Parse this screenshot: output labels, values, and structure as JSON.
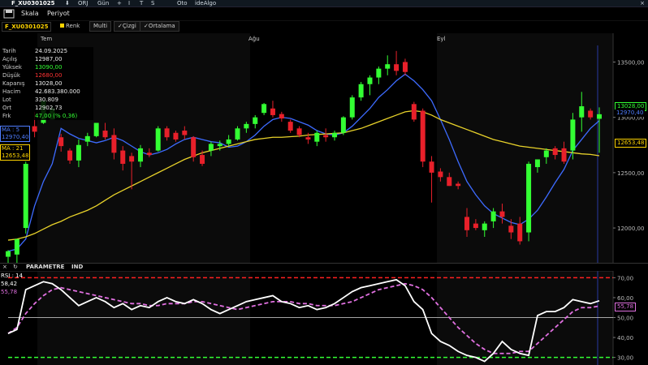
{
  "topbar": {
    "symbol": "F_XU0301025",
    "items": [
      "ORJ",
      "Gün",
      "+",
      "I",
      "T",
      "S",
      "Oto",
      "ideAlgo"
    ],
    "close": "×"
  },
  "menubar": {
    "items": [
      "Skala",
      "Periyot"
    ]
  },
  "toolbar": {
    "symbol": "F_XU0301025",
    "renk": "Renk",
    "buttons": [
      "Multi",
      "Çizgi",
      "Ortalama"
    ]
  },
  "info": {
    "rows": [
      {
        "label": "Tarih",
        "value": "24.09.2025",
        "color": "#eeeeee"
      },
      {
        "label": "Açılış",
        "value": "12987,00",
        "color": "#eeeeee"
      },
      {
        "label": "Yüksek",
        "value": "13090,00",
        "color": "#33ff33"
      },
      {
        "label": "Düşük",
        "value": "12680,00",
        "color": "#ff3333"
      },
      {
        "label": "Kapanış",
        "value": "13028,00",
        "color": "#eeeeee"
      },
      {
        "label": "Hacim",
        "value": "42.683.380.000",
        "color": "#eeeeee"
      },
      {
        "label": "Lot",
        "value": "330.809",
        "color": "#eeeeee"
      },
      {
        "label": "Ort",
        "value": "12902,73",
        "color": "#eeeeee"
      },
      {
        "label": "Frk",
        "value": "47,00 (% 0,36)",
        "color": "#33ff33"
      }
    ]
  },
  "ma5": {
    "label": "MA : 5",
    "value": "12970,40",
    "color": "#4f7dff"
  },
  "ma21": {
    "label": "MA : 21",
    "value": "12653,48",
    "color": "#ffd400"
  },
  "months": [
    "Tem",
    "Ağu",
    "Eyl"
  ],
  "indicator_header": {
    "title": "PARAMETRE",
    "ind": "IND",
    "close": "×",
    "refresh": "↻"
  },
  "rsi": {
    "label": "RSI : 14",
    "value": "58,42",
    "ma_value": "55,78"
  },
  "price_labels": {
    "last": "13028,00",
    "ma5": "12970,40",
    "ma21": "12653,48"
  },
  "rsi_labels": {
    "ma": "55,78"
  },
  "colors": {
    "up": "#33ff33",
    "down": "#e8202a",
    "ma5": "#3d6bff",
    "ma21": "#e8d22a",
    "rsi": "#ffffff",
    "rsi_ma": "#e070e0",
    "band_high": "#ff2020",
    "band_low": "#33ff33"
  },
  "chart_data": [
    {
      "type": "candlestick",
      "title": "F_XU0301025",
      "x_ticks": [
        "Tem",
        "Ağu",
        "Eyl"
      ],
      "ylim": [
        11700,
        13650
      ],
      "y_ticks": [
        12000,
        12500,
        13000,
        13500
      ],
      "y_tick_labels": [
        "12000,00",
        "12500,00",
        "13000,00",
        "13500,00"
      ],
      "grid": false,
      "candles": [
        {
          "o": 11740,
          "h": 11800,
          "l": 11680,
          "c": 11790
        },
        {
          "o": 11760,
          "h": 11900,
          "l": 11620,
          "c": 11900
        },
        {
          "o": 12000,
          "h": 12600,
          "l": 11950,
          "c": 12580
        },
        {
          "o": 12920,
          "h": 13050,
          "l": 12820,
          "c": 12870
        },
        {
          "o": 12950,
          "h": 13150,
          "l": 12940,
          "c": 13150
        },
        {
          "o": 12980,
          "h": 13100,
          "l": 12980,
          "c": 13080
        },
        {
          "o": 12820,
          "h": 12850,
          "l": 12690,
          "c": 12740
        },
        {
          "o": 12700,
          "h": 12720,
          "l": 12580,
          "c": 12610
        },
        {
          "o": 12610,
          "h": 12800,
          "l": 12550,
          "c": 12750
        },
        {
          "o": 12780,
          "h": 12860,
          "l": 12740,
          "c": 12830
        },
        {
          "o": 12830,
          "h": 12950,
          "l": 12820,
          "c": 12950
        },
        {
          "o": 12880,
          "h": 12950,
          "l": 12800,
          "c": 12820
        },
        {
          "o": 12840,
          "h": 12900,
          "l": 12620,
          "c": 12680
        },
        {
          "o": 12700,
          "h": 12740,
          "l": 12520,
          "c": 12580
        },
        {
          "o": 12650,
          "h": 12680,
          "l": 12350,
          "c": 12600
        },
        {
          "o": 12600,
          "h": 12750,
          "l": 12550,
          "c": 12720
        },
        {
          "o": 12680,
          "h": 12720,
          "l": 12640,
          "c": 12660
        },
        {
          "o": 12700,
          "h": 12920,
          "l": 12690,
          "c": 12900
        },
        {
          "o": 12900,
          "h": 12920,
          "l": 12790,
          "c": 12820
        },
        {
          "o": 12860,
          "h": 12880,
          "l": 12780,
          "c": 12800
        },
        {
          "o": 12880,
          "h": 12920,
          "l": 12800,
          "c": 12840
        },
        {
          "o": 12820,
          "h": 12830,
          "l": 12600,
          "c": 12640
        },
        {
          "o": 12660,
          "h": 12700,
          "l": 12560,
          "c": 12580
        },
        {
          "o": 12700,
          "h": 12780,
          "l": 12650,
          "c": 12760
        },
        {
          "o": 12740,
          "h": 12790,
          "l": 12700,
          "c": 12760
        },
        {
          "o": 12760,
          "h": 12840,
          "l": 12740,
          "c": 12800
        },
        {
          "o": 12800,
          "h": 12920,
          "l": 12790,
          "c": 12900
        },
        {
          "o": 12900,
          "h": 12960,
          "l": 12860,
          "c": 12940
        },
        {
          "o": 12940,
          "h": 13020,
          "l": 12900,
          "c": 13000
        },
        {
          "o": 13040,
          "h": 13130,
          "l": 13020,
          "c": 13120
        },
        {
          "o": 13080,
          "h": 13150,
          "l": 13000,
          "c": 13020
        },
        {
          "o": 13030,
          "h": 13050,
          "l": 12960,
          "c": 12990
        },
        {
          "o": 12960,
          "h": 12980,
          "l": 12860,
          "c": 12880
        },
        {
          "o": 12900,
          "h": 12920,
          "l": 12820,
          "c": 12840
        },
        {
          "o": 12820,
          "h": 12860,
          "l": 12760,
          "c": 12800
        },
        {
          "o": 12780,
          "h": 12880,
          "l": 12740,
          "c": 12860
        },
        {
          "o": 12840,
          "h": 12900,
          "l": 12780,
          "c": 12820
        },
        {
          "o": 12820,
          "h": 12880,
          "l": 12790,
          "c": 12860
        },
        {
          "o": 12860,
          "h": 13010,
          "l": 12840,
          "c": 13000
        },
        {
          "o": 13000,
          "h": 13200,
          "l": 12980,
          "c": 13180
        },
        {
          "o": 13180,
          "h": 13320,
          "l": 13150,
          "c": 13300
        },
        {
          "o": 13300,
          "h": 13380,
          "l": 13200,
          "c": 13360
        },
        {
          "o": 13360,
          "h": 13460,
          "l": 13300,
          "c": 13440
        },
        {
          "o": 13440,
          "h": 13560,
          "l": 13380,
          "c": 13480
        },
        {
          "o": 13480,
          "h": 13600,
          "l": 13380,
          "c": 13420
        },
        {
          "o": 13500,
          "h": 13530,
          "l": 13380,
          "c": 13410
        },
        {
          "o": 13120,
          "h": 13140,
          "l": 12960,
          "c": 12980
        },
        {
          "o": 13060,
          "h": 13080,
          "l": 12550,
          "c": 12600
        },
        {
          "o": 12600,
          "h": 12650,
          "l": 12230,
          "c": 12500
        },
        {
          "o": 12510,
          "h": 12540,
          "l": 12420,
          "c": 12460
        },
        {
          "o": 12460,
          "h": 12500,
          "l": 12380,
          "c": 12380
        },
        {
          "o": 12400,
          "h": 12420,
          "l": 12350,
          "c": 12380
        },
        {
          "o": 12100,
          "h": 12180,
          "l": 11920,
          "c": 11980
        },
        {
          "o": 12040,
          "h": 12080,
          "l": 11980,
          "c": 12000
        },
        {
          "o": 11980,
          "h": 12060,
          "l": 11920,
          "c": 12040
        },
        {
          "o": 12060,
          "h": 12180,
          "l": 12000,
          "c": 12150
        },
        {
          "o": 12150,
          "h": 12220,
          "l": 12040,
          "c": 12100
        },
        {
          "o": 12020,
          "h": 12080,
          "l": 11900,
          "c": 11960
        },
        {
          "o": 12040,
          "h": 12100,
          "l": 11850,
          "c": 11880
        },
        {
          "o": 11960,
          "h": 12600,
          "l": 11880,
          "c": 12580
        },
        {
          "o": 12550,
          "h": 12620,
          "l": 12500,
          "c": 12620
        },
        {
          "o": 12640,
          "h": 12720,
          "l": 12580,
          "c": 12700
        },
        {
          "o": 12720,
          "h": 12740,
          "l": 12620,
          "c": 12660
        },
        {
          "o": 12720,
          "h": 12780,
          "l": 12580,
          "c": 12600
        },
        {
          "o": 12700,
          "h": 13040,
          "l": 12620,
          "c": 12980
        },
        {
          "o": 13000,
          "h": 13230,
          "l": 12870,
          "c": 13100
        },
        {
          "o": 13060,
          "h": 13080,
          "l": 12980,
          "c": 13000
        },
        {
          "o": 12987,
          "h": 13090,
          "l": 12680,
          "c": 13028
        }
      ],
      "series": [
        {
          "name": "MA : 5",
          "values": [
            11790,
            11810,
            11900,
            12200,
            12420,
            12580,
            12900,
            12850,
            12810,
            12790,
            12770,
            12790,
            12820,
            12790,
            12740,
            12690,
            12660,
            12680,
            12710,
            12760,
            12800,
            12820,
            12800,
            12780,
            12770,
            12730,
            12740,
            12780,
            12840,
            12920,
            12980,
            13000,
            12990,
            12960,
            12930,
            12880,
            12850,
            12840,
            12860,
            12920,
            13000,
            13080,
            13180,
            13250,
            13330,
            13390,
            13330,
            13250,
            13150,
            12980,
            12800,
            12600,
            12420,
            12300,
            12200,
            12130,
            12090,
            12050,
            12030,
            12080,
            12160,
            12280,
            12410,
            12530,
            12700,
            12800,
            12900,
            12970
          ]
        },
        {
          "name": "MA : 21",
          "values": [
            11890,
            11900,
            11920,
            11950,
            11990,
            12030,
            12060,
            12100,
            12130,
            12160,
            12200,
            12250,
            12300,
            12340,
            12380,
            12420,
            12460,
            12500,
            12540,
            12580,
            12620,
            12650,
            12680,
            12700,
            12720,
            12740,
            12760,
            12780,
            12800,
            12810,
            12820,
            12820,
            12825,
            12830,
            12840,
            12845,
            12850,
            12855,
            12860,
            12880,
            12900,
            12930,
            12960,
            12990,
            13020,
            13050,
            13060,
            13050,
            13020,
            12980,
            12950,
            12920,
            12890,
            12860,
            12830,
            12800,
            12780,
            12760,
            12740,
            12730,
            12720,
            12710,
            12700,
            12690,
            12680,
            12670,
            12665,
            12653
          ]
        }
      ]
    },
    {
      "type": "line",
      "title": "RSI : 14",
      "ylim": [
        27,
        73
      ],
      "y_ticks": [
        30,
        40,
        50,
        60,
        70
      ],
      "y_tick_labels": [
        "30,00",
        "40,00",
        "50,00",
        "60,00",
        "70,00"
      ],
      "bands": {
        "high": 70,
        "low": 30,
        "mid": 50
      },
      "series": [
        {
          "name": "RSI : 14",
          "values": [
            42,
            44,
            64,
            66,
            68,
            67,
            64,
            60,
            56,
            58,
            60,
            58,
            55,
            57,
            54,
            56,
            55,
            58,
            60,
            58,
            57,
            59,
            57,
            54,
            52,
            54,
            56,
            58,
            59,
            60,
            61,
            58,
            57,
            55,
            56,
            54,
            55,
            57,
            60,
            63,
            65,
            66,
            67,
            68,
            69,
            66,
            58,
            54,
            42,
            38,
            36,
            33,
            31,
            30,
            28,
            32,
            38,
            34,
            32,
            31,
            51,
            53,
            53,
            55,
            59,
            58,
            57,
            58.42
          ]
        },
        {
          "name": "RSI MA",
          "values": [
            42,
            45,
            52,
            57,
            61,
            64,
            65,
            64,
            63,
            62,
            61,
            60,
            59,
            58,
            57,
            57,
            56,
            56,
            57,
            57,
            57,
            58,
            58,
            57,
            56,
            55,
            54,
            55,
            56,
            57,
            58,
            58,
            58,
            57,
            57,
            56,
            56,
            56,
            57,
            58,
            60,
            62,
            64,
            65,
            66,
            67,
            66,
            64,
            60,
            55,
            50,
            45,
            41,
            37,
            34,
            32,
            32,
            32,
            33,
            33,
            37,
            41,
            45,
            49,
            53,
            55,
            55,
            55.78
          ]
        }
      ]
    }
  ]
}
